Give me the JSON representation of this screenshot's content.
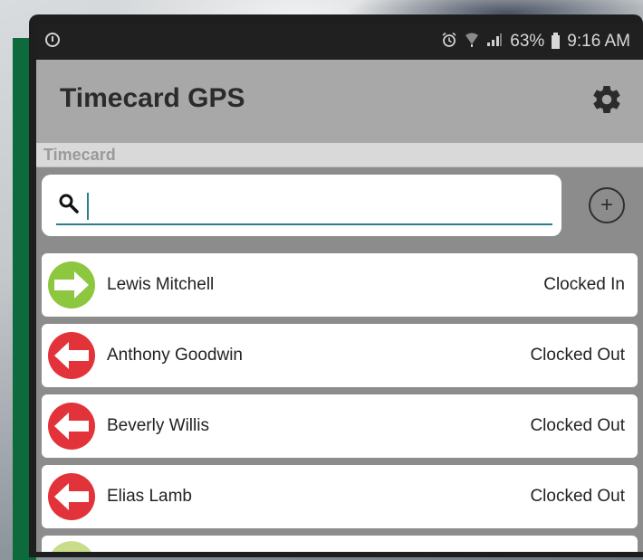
{
  "status_bar": {
    "battery_percent": "63%",
    "time": "9:16 AM",
    "icons": [
      "alarm-icon",
      "wifi-icon",
      "signal-icon",
      "battery-icon"
    ]
  },
  "app": {
    "title": "Timecard GPS",
    "settings_icon": "gear-icon"
  },
  "section": {
    "label": "Timecard"
  },
  "search": {
    "value": "",
    "placeholder": ""
  },
  "add_button": {
    "icon": "plus-circle-icon"
  },
  "colors": {
    "clocked_in": "#8dc63f",
    "clocked_out": "#e2333a",
    "accent": "#2a7f86",
    "app_bar": "#a8a8a8"
  },
  "employees": [
    {
      "name": "Lewis Mitchell",
      "status": "Clocked In",
      "direction": "in"
    },
    {
      "name": "Anthony Goodwin",
      "status": "Clocked Out",
      "direction": "out"
    },
    {
      "name": "Beverly Willis",
      "status": "Clocked Out",
      "direction": "out"
    },
    {
      "name": "Elias Lamb",
      "status": "Clocked Out",
      "direction": "out"
    }
  ]
}
